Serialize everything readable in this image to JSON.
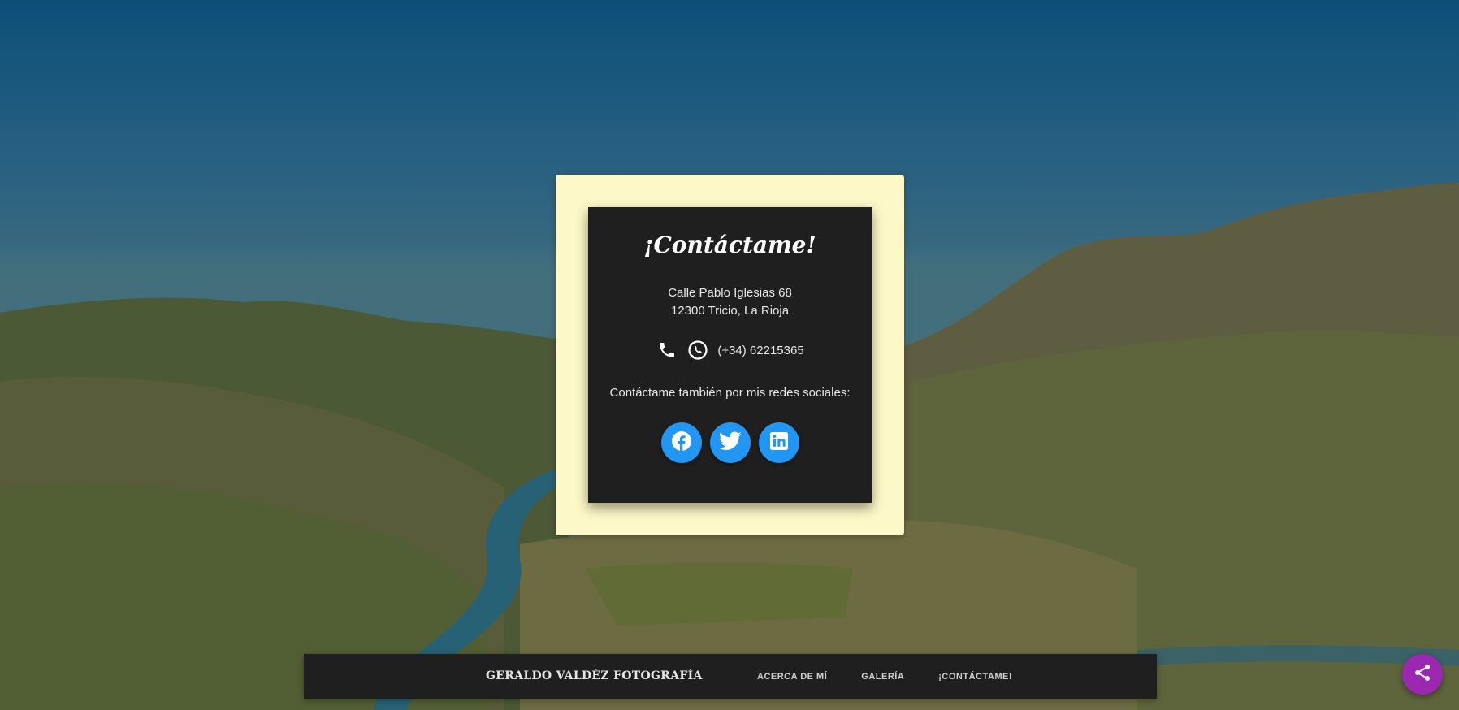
{
  "contact": {
    "title": "¡Contáctame!",
    "address_line1": "Calle Pablo Iglesias 68",
    "address_line2": "12300 Tricio, La Rioja",
    "phone": "(+34) 62215365",
    "social_text": "Contáctame también por mis redes sociales:",
    "social_links": [
      {
        "icon": "facebook-icon"
      },
      {
        "icon": "twitter-icon"
      },
      {
        "icon": "linkedin-icon"
      }
    ]
  },
  "footer": {
    "brand": "GERALDO VALDÉZ FOTOGRAFÍA",
    "nav": [
      {
        "label": "ACERCA DE MÍ"
      },
      {
        "label": "GALERÍA"
      },
      {
        "label": "¡CONTÁCTAME!"
      }
    ]
  },
  "colors": {
    "card_outer": "#fdf8c7",
    "card_inner": "#1f1f1f",
    "social_button": "#2196f3",
    "share_button": "#9c27b0",
    "footer_bg": "#1f1f1f"
  },
  "icons": {
    "phone": "phone-icon",
    "whatsapp": "whatsapp-icon",
    "share": "share-icon"
  }
}
